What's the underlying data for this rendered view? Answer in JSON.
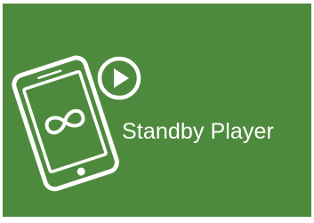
{
  "app": {
    "title": "Standby Player"
  },
  "icons": {
    "device": "smartphone-icon",
    "loop": "infinity-loop-icon",
    "play": "play-circle-icon"
  },
  "colors": {
    "background": "#4e8a3d",
    "foreground": "#ffffff",
    "border": "#ffffff"
  }
}
